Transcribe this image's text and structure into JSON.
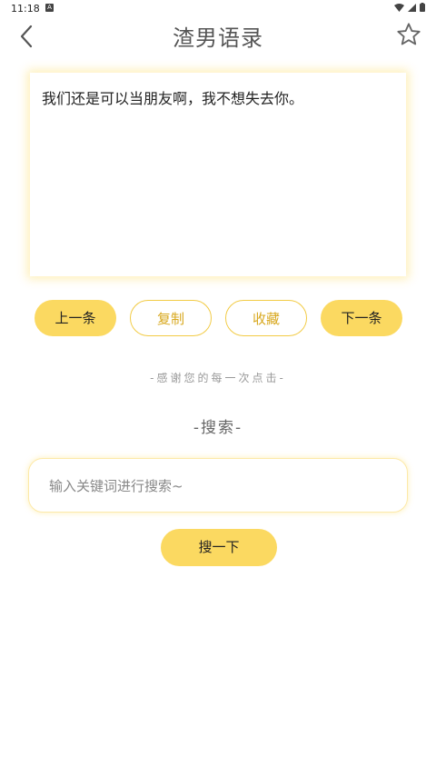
{
  "status": {
    "time": "11:18",
    "a_badge": "A"
  },
  "header": {
    "title": "渣男语录"
  },
  "quote": {
    "text": "我们还是可以当朋友啊，我不想失去你。"
  },
  "actions": {
    "prev_label": "上一条",
    "copy_label": "复制",
    "favorite_label": "收藏",
    "next_label": "下一条"
  },
  "thanks_text": "-感谢您的每一次点击-",
  "search": {
    "section_title": "-搜索-",
    "placeholder": "输入关键词进行搜索~",
    "value": "",
    "button_label": "搜一下"
  },
  "colors": {
    "accent": "#fbd961",
    "accent_text": "#d8a81e"
  }
}
